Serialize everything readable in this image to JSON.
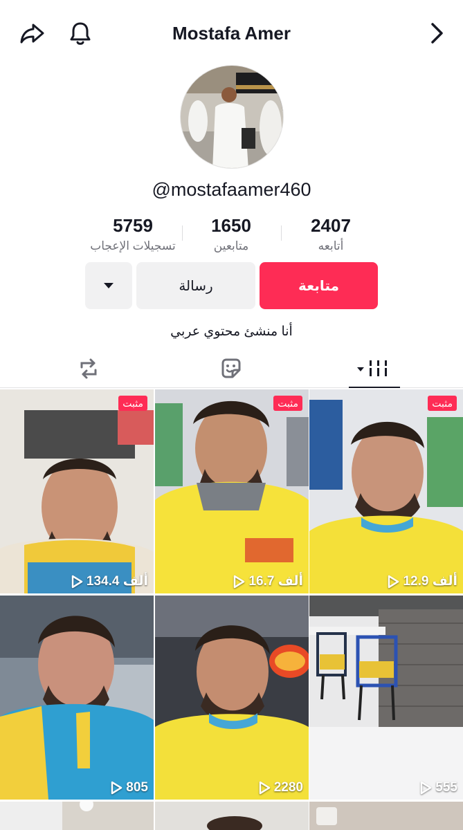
{
  "header": {
    "title": "Mostafa Amer",
    "share_icon": "share-icon",
    "bell_icon": "bell-icon",
    "next_icon": "chevron-right-icon"
  },
  "profile": {
    "handle": "@mostafaamer460",
    "bio": "أنا منشئ محتوي عربي"
  },
  "stats": {
    "likes": {
      "value": "5759",
      "label": "تسجيلات الإعجاب"
    },
    "followers": {
      "value": "1650",
      "label": "متابعين"
    },
    "following": {
      "value": "2407",
      "label": "أتابعه"
    }
  },
  "actions": {
    "follow_label": "متابعة",
    "message_label": "رسالة",
    "more_icon": "caret-down-icon"
  },
  "colors": {
    "accent": "#fe2c55",
    "secondary_button": "#f1f1f2"
  },
  "videos": [
    {
      "pinned": "مثبت",
      "views": "134.4 ألف"
    },
    {
      "pinned": "مثبت",
      "views": "16.7 ألف"
    },
    {
      "pinned": "مثبت",
      "views": "12.9 ألف"
    },
    {
      "views": "805"
    },
    {
      "views": "2280"
    },
    {
      "views": "555"
    }
  ]
}
